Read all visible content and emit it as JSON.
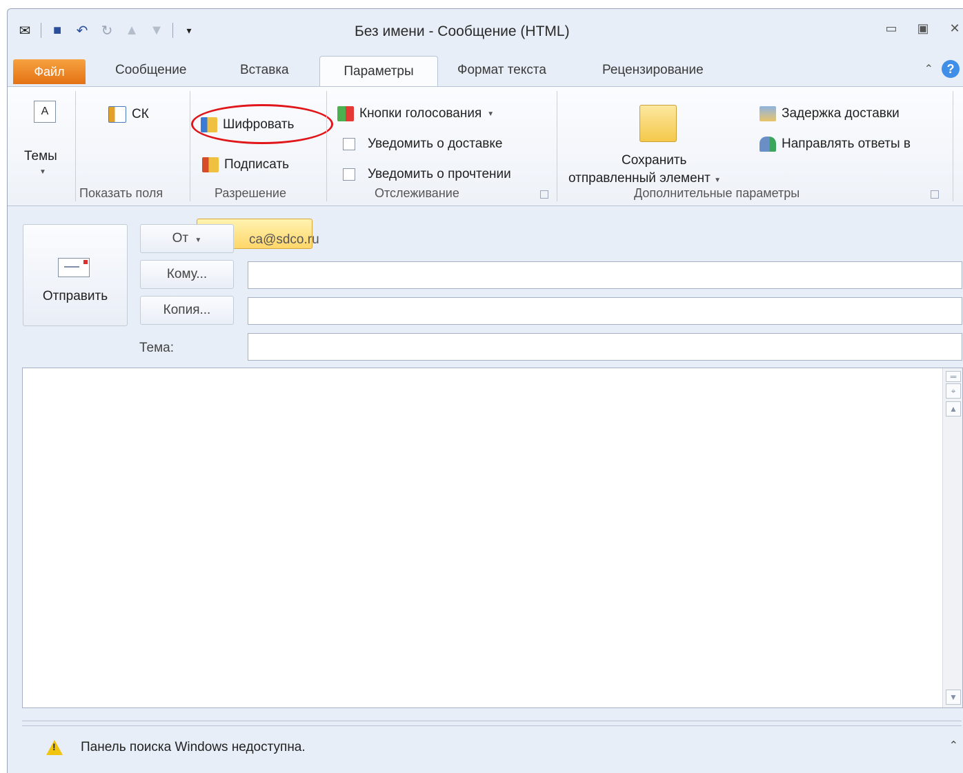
{
  "window": {
    "title": "Без имени  -  Сообщение (HTML)"
  },
  "tabs": {
    "file": "Файл",
    "message": "Сообщение",
    "insert": "Вставка",
    "options": "Параметры",
    "format": "Формат текста",
    "review": "Рецензирование"
  },
  "ribbon": {
    "themes": "Темы",
    "show_fields": {
      "bcc": "СК",
      "label": "Показать поля"
    },
    "permission": {
      "encrypt": "Шифровать",
      "sign": "Подписать",
      "label": "Разрешение"
    },
    "tracking": {
      "voting": "Кнопки голосования",
      "delivery": "Уведомить о доставке",
      "read": "Уведомить о прочтении",
      "label": "Отслеживание"
    },
    "more": {
      "save_sent_1": "Сохранить",
      "save_sent_2": "отправленный элемент",
      "delay": "Задержка доставки",
      "reply_to": "Направлять ответы в",
      "label": "Дополнительные параметры"
    }
  },
  "compose": {
    "send": "Отправить",
    "from": "От",
    "from_value": "ca@sdco.ru",
    "to": "Кому...",
    "cc": "Копия...",
    "subject": "Тема:"
  },
  "status": {
    "message": "Панель поиска Windows недоступна."
  }
}
